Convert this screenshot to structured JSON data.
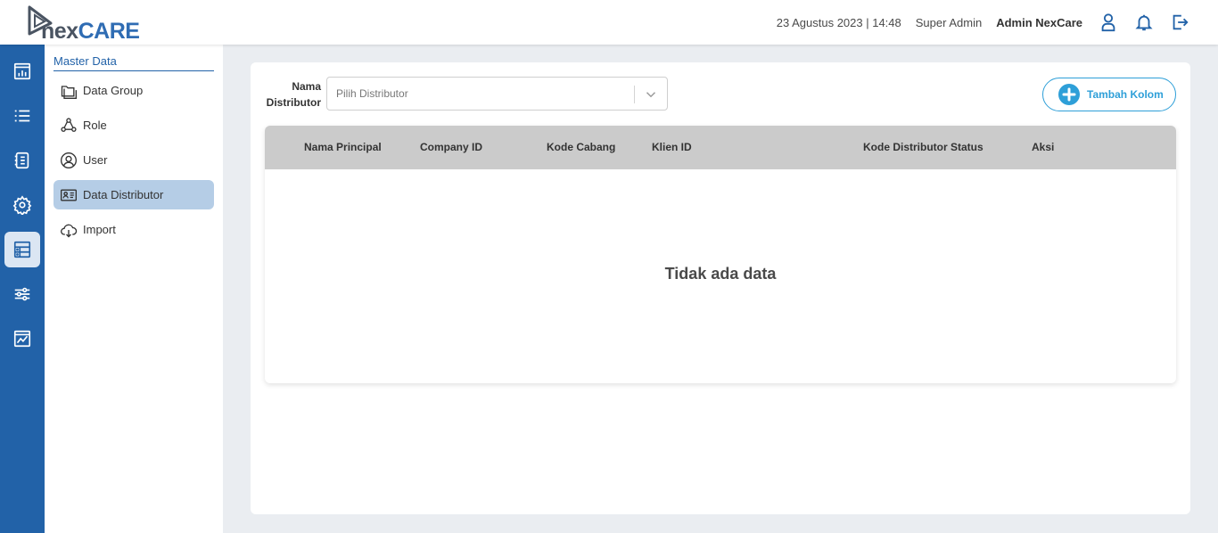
{
  "brand": {
    "logo_part1": "nex",
    "logo_part2": "CARE",
    "colors": {
      "primary": "#2262a8",
      "accent": "#2e9fd8",
      "logo_dark": "#4a5462"
    }
  },
  "header": {
    "datetime": "23 Agustus 2023 | 14:48",
    "role": "Super Admin",
    "user": "Admin NexCare",
    "icons": [
      "user-icon",
      "bell-icon",
      "logout-icon"
    ]
  },
  "rail": {
    "items": [
      {
        "icon": "dashboard-icon",
        "active": false
      },
      {
        "icon": "list-icon",
        "active": false
      },
      {
        "icon": "document-icon",
        "active": false
      },
      {
        "icon": "settings-icon",
        "active": false
      },
      {
        "icon": "master-data-icon",
        "active": true
      },
      {
        "icon": "sliders-icon",
        "active": false
      },
      {
        "icon": "report-chart-icon",
        "active": false
      }
    ]
  },
  "submenu": {
    "title": "Master Data",
    "items": [
      {
        "label": "Data Group",
        "icon": "folders-icon",
        "active": false
      },
      {
        "label": "Role",
        "icon": "role-network-icon",
        "active": false
      },
      {
        "label": "User",
        "icon": "user-circle-icon",
        "active": false
      },
      {
        "label": "Data Distributor",
        "icon": "id-card-icon",
        "active": true
      },
      {
        "label": "Import",
        "icon": "cloud-download-icon",
        "active": false
      }
    ]
  },
  "main": {
    "filter": {
      "label_line1": "Nama",
      "label_line2": "Distributor",
      "placeholder": "Pilih Distributor"
    },
    "add_button": "Tambah Kolom",
    "table": {
      "columns": [
        "Nama Principal",
        "Company ID",
        "Kode Cabang",
        "Klien ID",
        "Kode Distributor Status",
        "Aksi"
      ],
      "rows": [],
      "empty_text": "Tidak ada data"
    }
  }
}
